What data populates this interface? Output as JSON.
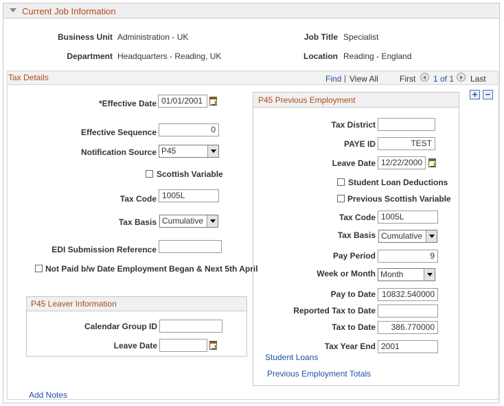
{
  "section": {
    "title": "Current Job Information"
  },
  "job": {
    "business_unit_label": "Business Unit",
    "business_unit_value": "Administration - UK",
    "job_title_label": "Job Title",
    "job_title_value": "Specialist",
    "department_label": "Department",
    "department_value": "Headquarters - Reading, UK",
    "location_label": "Location",
    "location_value": "Reading - England"
  },
  "tax_details": {
    "title": "Tax Details",
    "find": "Find",
    "separator": "|",
    "view_all": "View All",
    "first": "First",
    "range": "1 of 1",
    "last": "Last",
    "add_button": "+",
    "remove_button": "−"
  },
  "form": {
    "effective_date_label": "*Effective Date",
    "effective_date_value": "01/01/2001",
    "effective_sequence_label": "Effective Sequence",
    "effective_sequence_value": "0",
    "notification_source_label": "Notification Source",
    "notification_source_value": "P45",
    "scottish_variable_label": "Scottish Variable",
    "tax_code_label": "Tax Code",
    "tax_code_value": "1005L",
    "tax_basis_label": "Tax Basis",
    "tax_basis_value": "Cumulative",
    "edi_label": "EDI Submission Reference",
    "edi_value": "",
    "not_paid_label": "Not Paid b/w Date Employment Began & Next 5th April"
  },
  "leaver": {
    "title": "P45 Leaver Information",
    "calendar_group_label": "Calendar Group ID",
    "calendar_group_value": "",
    "leave_date_label": "Leave Date",
    "leave_date_value": ""
  },
  "p45_prev": {
    "title": "P45 Previous Employment",
    "tax_district_label": "Tax District",
    "tax_district_value": "",
    "paye_id_label": "PAYE ID",
    "paye_id_value": "TEST",
    "leave_date_label": "Leave Date",
    "leave_date_value": "12/22/2000",
    "student_loan_label": "Student Loan Deductions",
    "prev_scottish_label": "Previous Scottish Variable",
    "tax_code_label": "Tax Code",
    "tax_code_value": "1005L",
    "tax_basis_label": "Tax Basis",
    "tax_basis_value": "Cumulative",
    "pay_period_label": "Pay Period",
    "pay_period_value": "9",
    "week_month_label": "Week or Month",
    "week_month_value": "Month",
    "pay_to_date_label": "Pay to Date",
    "pay_to_date_value": "10832.540000",
    "reported_tax_label": "Reported Tax to Date",
    "reported_tax_value": "",
    "tax_to_date_label": "Tax to Date",
    "tax_to_date_value": "386.770000",
    "tax_year_end_label": "Tax Year End",
    "tax_year_end_value": "2001",
    "student_loans_link": "Student Loans",
    "prev_totals_link": "Previous Employment Totals"
  },
  "footer": {
    "add_notes": "Add Notes"
  }
}
